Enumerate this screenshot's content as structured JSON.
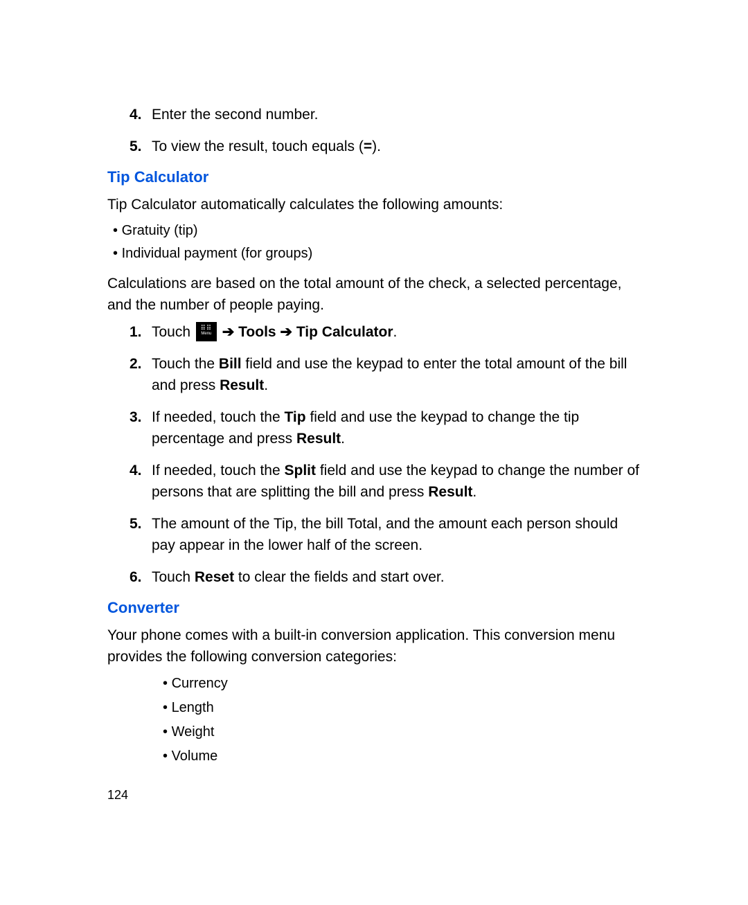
{
  "intro_steps": {
    "s4_num": "4.",
    "s4_text": "Enter the second number.",
    "s5_num": "5.",
    "s5_text_a": "To view the result, touch equals (",
    "s5_eq": "=",
    "s5_text_b": ")."
  },
  "tip_calc": {
    "heading": "Tip Calculator",
    "intro": "Tip Calculator automatically calculates the following amounts:",
    "bullets": {
      "b1": "Gratuity (tip)",
      "b2": "Individual payment (for groups)"
    },
    "desc": "Calculations are based on the total amount of the check, a selected percentage, and the number of people paying.",
    "steps": {
      "s1_num": "1.",
      "s1_a": "Touch ",
      "s1_menu_label": "Menu",
      "s1_arrow1": " ➔ ",
      "s1_tools": "Tools",
      "s1_arrow2": " ➔ ",
      "s1_tipcalc": "Tip Calculator",
      "s1_period": ".",
      "s2_num": "2.",
      "s2_a": "Touch the ",
      "s2_bill": "Bill",
      "s2_b": " field and use the keypad to enter the total amount of the bill and press ",
      "s2_result": "Result",
      "s2_c": ".",
      "s3_num": "3.",
      "s3_a": "If needed, touch the ",
      "s3_tip": "Tip",
      "s3_b": " field and use the keypad to change the tip percentage and press ",
      "s3_result": "Result",
      "s3_c": ".",
      "s4_num": "4.",
      "s4_a": "If needed, touch the ",
      "s4_split": "Split",
      "s4_b": " field and use the keypad to change the number of persons that are splitting the bill and press ",
      "s4_result": "Result",
      "s4_c": ".",
      "s5_num": "5.",
      "s5_text": "The amount of the Tip, the bill Total, and the amount each person should pay appear in the lower half of the screen.",
      "s6_num": "6.",
      "s6_a": "Touch ",
      "s6_reset": "Reset",
      "s6_b": " to clear the fields and start over."
    }
  },
  "converter": {
    "heading": "Converter",
    "intro": "Your phone comes with a built-in conversion application. This conversion menu provides the following conversion categories:",
    "bullets": {
      "b1": "Currency",
      "b2": "Length",
      "b3": "Weight",
      "b4": "Volume"
    }
  },
  "page_number": "124"
}
